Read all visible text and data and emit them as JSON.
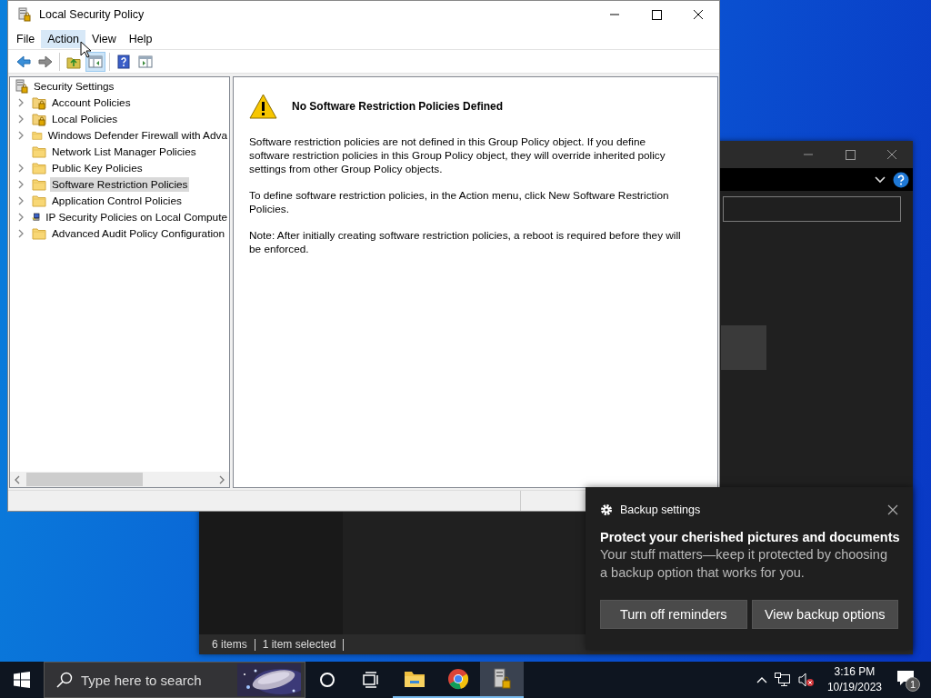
{
  "explorer_window": {
    "status_bar": [
      "6 items",
      "1 item selected"
    ]
  },
  "main_window": {
    "title": "Local Security Policy",
    "menu": [
      {
        "label": "File",
        "hovered": false
      },
      {
        "label": "Action",
        "hovered": true
      },
      {
        "label": "View",
        "hovered": false
      },
      {
        "label": "Help",
        "hovered": false
      }
    ],
    "toolbar": [
      [
        {
          "kind": "back",
          "pressed": false
        },
        {
          "kind": "forward",
          "pressed": false
        }
      ],
      [
        {
          "kind": "up",
          "pressed": false
        },
        {
          "kind": "tree-toggle",
          "pressed": true
        }
      ],
      [
        {
          "kind": "help",
          "pressed": false
        },
        {
          "kind": "export",
          "pressed": false
        }
      ]
    ],
    "tree": {
      "label": "Security Settings",
      "kind": "security",
      "selected": false,
      "children": [
        {
          "label": "Account Policies",
          "kind": "locked-folder",
          "expandable": true,
          "selected": false
        },
        {
          "label": "Local Policies",
          "kind": "locked-folder",
          "expandable": true,
          "selected": false
        },
        {
          "label": "Windows Defender Firewall with Adva",
          "kind": "folder",
          "expandable": true,
          "selected": false
        },
        {
          "label": "Network List Manager Policies",
          "kind": "folder",
          "expandable": false,
          "selected": false
        },
        {
          "label": "Public Key Policies",
          "kind": "folder",
          "expandable": true,
          "selected": false
        },
        {
          "label": "Software Restriction Policies",
          "kind": "folder",
          "expandable": true,
          "selected": true
        },
        {
          "label": "Application Control Policies",
          "kind": "folder",
          "expandable": true,
          "selected": false
        },
        {
          "label": "IP Security Policies on Local Compute",
          "kind": "ip-security",
          "expandable": true,
          "selected": false
        },
        {
          "label": "Advanced Audit Policy Configuration",
          "kind": "folder",
          "expandable": true,
          "selected": false
        }
      ]
    },
    "content": {
      "heading": "No Software Restriction Policies Defined",
      "paragraphs": [
        "Software restriction policies are not defined in this Group Policy object. If you define software restriction policies in this Group Policy object, they will override inherited policy settings from other Group Policy objects.",
        "To define software restriction policies, in the Action menu, click New Software Restriction Policies.",
        "Note: After initially creating software restriction policies, a reboot is required before they will be enforced."
      ]
    }
  },
  "notification": {
    "app": "Backup settings",
    "title": "Protect your cherished pictures and documents",
    "body": "Your stuff matters—keep it protected by choosing a backup option that works for you.",
    "buttons": [
      "Turn off reminders",
      "View backup options"
    ]
  },
  "taskbar": {
    "search": {
      "placeholder": "Type here to search"
    },
    "apps": [
      {
        "kind": "cortana",
        "running": false,
        "active": false
      },
      {
        "kind": "task-view",
        "running": false,
        "active": false
      },
      {
        "kind": "file-explorer",
        "running": true,
        "active": false
      },
      {
        "kind": "browser",
        "running": true,
        "active": false
      },
      {
        "kind": "security-policy",
        "running": true,
        "active": true
      }
    ],
    "volume_muted": true,
    "clock": {
      "time": "3:16 PM",
      "date": "10/19/2023"
    },
    "notifications": {
      "count": "1"
    }
  }
}
